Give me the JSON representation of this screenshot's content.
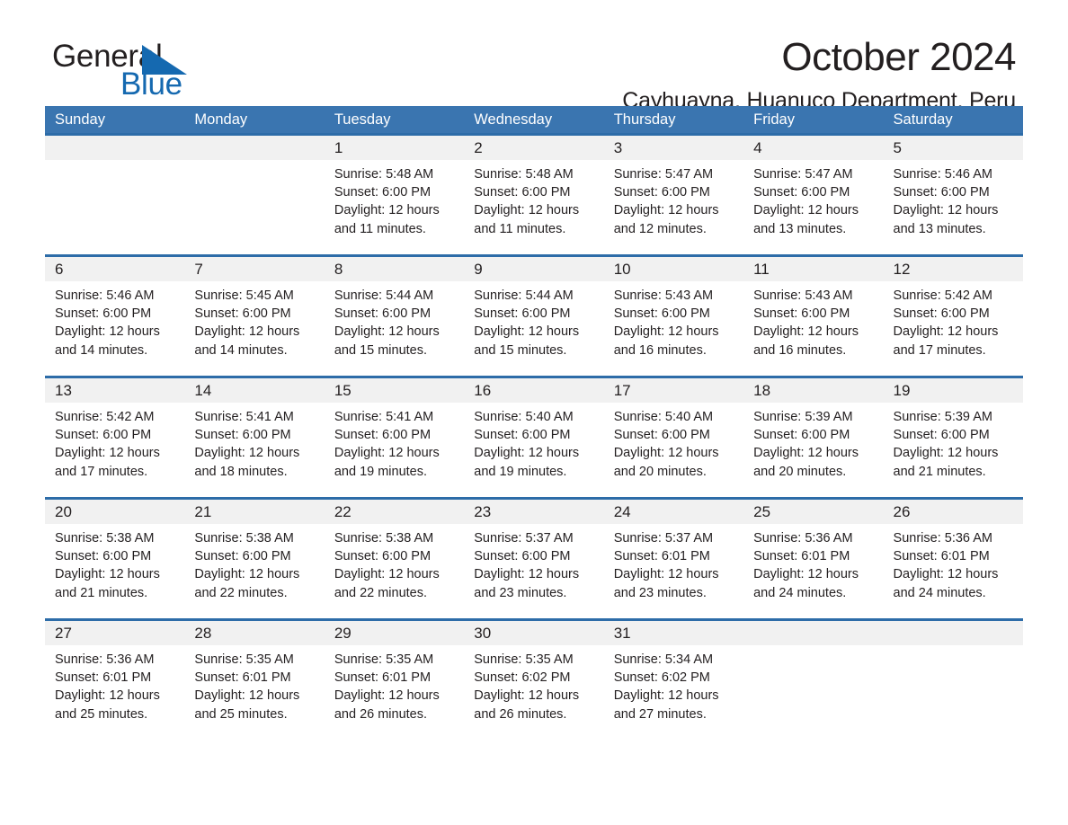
{
  "brand": {
    "word1": "General",
    "word2": "Blue",
    "flag_icon": "triangle-flag-icon",
    "accent_color": "#1569b0"
  },
  "header": {
    "month_title": "October 2024",
    "location": "Cayhuayna, Huanuco Department, Peru"
  },
  "calendar": {
    "header_color": "#3a75b0",
    "rule_color": "#2d6ca8",
    "daynum_band_color": "#f1f1f1",
    "weekdays": [
      "Sunday",
      "Monday",
      "Tuesday",
      "Wednesday",
      "Thursday",
      "Friday",
      "Saturday"
    ],
    "weeks": [
      [
        {
          "day": "",
          "lines": []
        },
        {
          "day": "",
          "lines": []
        },
        {
          "day": "1",
          "lines": [
            "Sunrise: 5:48 AM",
            "Sunset: 6:00 PM",
            "Daylight: 12 hours",
            "and 11 minutes."
          ]
        },
        {
          "day": "2",
          "lines": [
            "Sunrise: 5:48 AM",
            "Sunset: 6:00 PM",
            "Daylight: 12 hours",
            "and 11 minutes."
          ]
        },
        {
          "day": "3",
          "lines": [
            "Sunrise: 5:47 AM",
            "Sunset: 6:00 PM",
            "Daylight: 12 hours",
            "and 12 minutes."
          ]
        },
        {
          "day": "4",
          "lines": [
            "Sunrise: 5:47 AM",
            "Sunset: 6:00 PM",
            "Daylight: 12 hours",
            "and 13 minutes."
          ]
        },
        {
          "day": "5",
          "lines": [
            "Sunrise: 5:46 AM",
            "Sunset: 6:00 PM",
            "Daylight: 12 hours",
            "and 13 minutes."
          ]
        }
      ],
      [
        {
          "day": "6",
          "lines": [
            "Sunrise: 5:46 AM",
            "Sunset: 6:00 PM",
            "Daylight: 12 hours",
            "and 14 minutes."
          ]
        },
        {
          "day": "7",
          "lines": [
            "Sunrise: 5:45 AM",
            "Sunset: 6:00 PM",
            "Daylight: 12 hours",
            "and 14 minutes."
          ]
        },
        {
          "day": "8",
          "lines": [
            "Sunrise: 5:44 AM",
            "Sunset: 6:00 PM",
            "Daylight: 12 hours",
            "and 15 minutes."
          ]
        },
        {
          "day": "9",
          "lines": [
            "Sunrise: 5:44 AM",
            "Sunset: 6:00 PM",
            "Daylight: 12 hours",
            "and 15 minutes."
          ]
        },
        {
          "day": "10",
          "lines": [
            "Sunrise: 5:43 AM",
            "Sunset: 6:00 PM",
            "Daylight: 12 hours",
            "and 16 minutes."
          ]
        },
        {
          "day": "11",
          "lines": [
            "Sunrise: 5:43 AM",
            "Sunset: 6:00 PM",
            "Daylight: 12 hours",
            "and 16 minutes."
          ]
        },
        {
          "day": "12",
          "lines": [
            "Sunrise: 5:42 AM",
            "Sunset: 6:00 PM",
            "Daylight: 12 hours",
            "and 17 minutes."
          ]
        }
      ],
      [
        {
          "day": "13",
          "lines": [
            "Sunrise: 5:42 AM",
            "Sunset: 6:00 PM",
            "Daylight: 12 hours",
            "and 17 minutes."
          ]
        },
        {
          "day": "14",
          "lines": [
            "Sunrise: 5:41 AM",
            "Sunset: 6:00 PM",
            "Daylight: 12 hours",
            "and 18 minutes."
          ]
        },
        {
          "day": "15",
          "lines": [
            "Sunrise: 5:41 AM",
            "Sunset: 6:00 PM",
            "Daylight: 12 hours",
            "and 19 minutes."
          ]
        },
        {
          "day": "16",
          "lines": [
            "Sunrise: 5:40 AM",
            "Sunset: 6:00 PM",
            "Daylight: 12 hours",
            "and 19 minutes."
          ]
        },
        {
          "day": "17",
          "lines": [
            "Sunrise: 5:40 AM",
            "Sunset: 6:00 PM",
            "Daylight: 12 hours",
            "and 20 minutes."
          ]
        },
        {
          "day": "18",
          "lines": [
            "Sunrise: 5:39 AM",
            "Sunset: 6:00 PM",
            "Daylight: 12 hours",
            "and 20 minutes."
          ]
        },
        {
          "day": "19",
          "lines": [
            "Sunrise: 5:39 AM",
            "Sunset: 6:00 PM",
            "Daylight: 12 hours",
            "and 21 minutes."
          ]
        }
      ],
      [
        {
          "day": "20",
          "lines": [
            "Sunrise: 5:38 AM",
            "Sunset: 6:00 PM",
            "Daylight: 12 hours",
            "and 21 minutes."
          ]
        },
        {
          "day": "21",
          "lines": [
            "Sunrise: 5:38 AM",
            "Sunset: 6:00 PM",
            "Daylight: 12 hours",
            "and 22 minutes."
          ]
        },
        {
          "day": "22",
          "lines": [
            "Sunrise: 5:38 AM",
            "Sunset: 6:00 PM",
            "Daylight: 12 hours",
            "and 22 minutes."
          ]
        },
        {
          "day": "23",
          "lines": [
            "Sunrise: 5:37 AM",
            "Sunset: 6:00 PM",
            "Daylight: 12 hours",
            "and 23 minutes."
          ]
        },
        {
          "day": "24",
          "lines": [
            "Sunrise: 5:37 AM",
            "Sunset: 6:01 PM",
            "Daylight: 12 hours",
            "and 23 minutes."
          ]
        },
        {
          "day": "25",
          "lines": [
            "Sunrise: 5:36 AM",
            "Sunset: 6:01 PM",
            "Daylight: 12 hours",
            "and 24 minutes."
          ]
        },
        {
          "day": "26",
          "lines": [
            "Sunrise: 5:36 AM",
            "Sunset: 6:01 PM",
            "Daylight: 12 hours",
            "and 24 minutes."
          ]
        }
      ],
      [
        {
          "day": "27",
          "lines": [
            "Sunrise: 5:36 AM",
            "Sunset: 6:01 PM",
            "Daylight: 12 hours",
            "and 25 minutes."
          ]
        },
        {
          "day": "28",
          "lines": [
            "Sunrise: 5:35 AM",
            "Sunset: 6:01 PM",
            "Daylight: 12 hours",
            "and 25 minutes."
          ]
        },
        {
          "day": "29",
          "lines": [
            "Sunrise: 5:35 AM",
            "Sunset: 6:01 PM",
            "Daylight: 12 hours",
            "and 26 minutes."
          ]
        },
        {
          "day": "30",
          "lines": [
            "Sunrise: 5:35 AM",
            "Sunset: 6:02 PM",
            "Daylight: 12 hours",
            "and 26 minutes."
          ]
        },
        {
          "day": "31",
          "lines": [
            "Sunrise: 5:34 AM",
            "Sunset: 6:02 PM",
            "Daylight: 12 hours",
            "and 27 minutes."
          ]
        },
        {
          "day": "",
          "lines": []
        },
        {
          "day": "",
          "lines": []
        }
      ]
    ]
  }
}
